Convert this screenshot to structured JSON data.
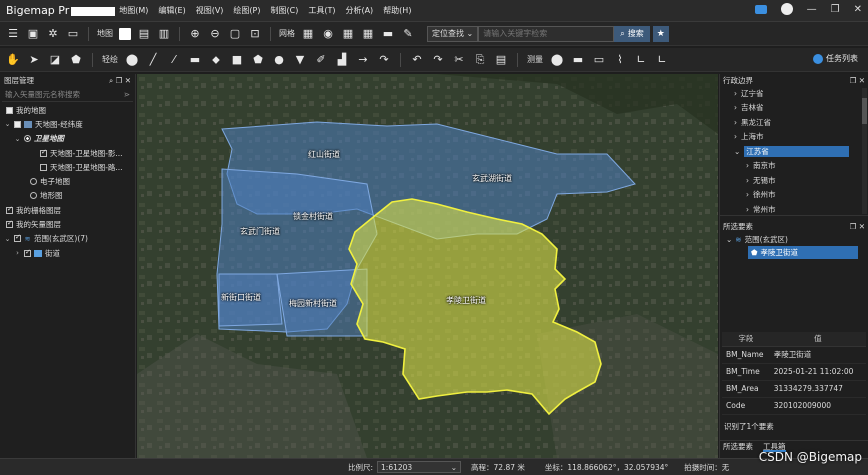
{
  "app": {
    "title": "Bigemap Pr",
    "menu": [
      "地图(M)",
      "编辑(E)",
      "视图(V)",
      "绘图(P)",
      "制图(C)",
      "工具(T)",
      "分析(A)",
      "帮助(H)"
    ]
  },
  "toolbar1": {
    "map_label": "地图",
    "grid_label": "网格",
    "search_type": "定位查找",
    "search_placeholder": "请输入关键字检索",
    "search_button": "搜索"
  },
  "toolbar2": {
    "light_label": "轻绘",
    "measure_label": "测量",
    "task_list": "任务列表"
  },
  "left_panel": {
    "title": "图层管理",
    "search_placeholder": "输入矢量图元名称搜索",
    "items": [
      {
        "label": "我的地图"
      },
      {
        "label": "天地图-经纬度"
      },
      {
        "label": "卫星地图"
      },
      {
        "label": "天地图-卫星地图-影..."
      },
      {
        "label": "天地图-卫星地图-路..."
      },
      {
        "label": "电子地图"
      },
      {
        "label": "地形图"
      },
      {
        "label": "我的栅格图层"
      },
      {
        "label": "我的矢量图层"
      },
      {
        "label": "范围(玄武区)(7)"
      },
      {
        "label": "街道"
      }
    ]
  },
  "map": {
    "labels": [
      "红山街道",
      "玄武湖街道",
      "锁金村街道",
      "玄武门街道",
      "新街口街道",
      "梅园新村街道",
      "孝陵卫街道"
    ]
  },
  "right_panel": {
    "admin_title": "行政边界",
    "admin_items": [
      "辽宁省",
      "吉林省",
      "黑龙江省",
      "上海市",
      "江苏省",
      "南京市",
      "无锡市",
      "徐州市",
      "常州市"
    ],
    "selected_title": "所选要素",
    "range_label": "范围(玄武区)",
    "selected_feature": "孝陵卫街道",
    "table_headers": [
      "字段",
      "值"
    ],
    "table_rows": [
      {
        "field": "BM_Name",
        "value": "孝陵卫街道"
      },
      {
        "field": "BM_Time",
        "value": "2025-01-21 11:02:00"
      },
      {
        "field": "BM_Area",
        "value": "31334279.337747"
      },
      {
        "field": "Code",
        "value": "320102009000"
      }
    ],
    "identified": "识别了1个要素",
    "tabs": [
      "所选要素",
      "工具箱"
    ]
  },
  "status": {
    "scale_label": "比例尺:",
    "scale_value": "1:61203",
    "elevation": "高程：72.87 米",
    "coords": "坐标：118.866062°，32.057934°",
    "capture": "拍摄时间：无"
  },
  "watermark": "CSDN @Bigemap",
  "colors": {
    "accent": "#3b8fe0",
    "selected_polygon": "#e8f04a",
    "district": "#5a8fd0"
  }
}
